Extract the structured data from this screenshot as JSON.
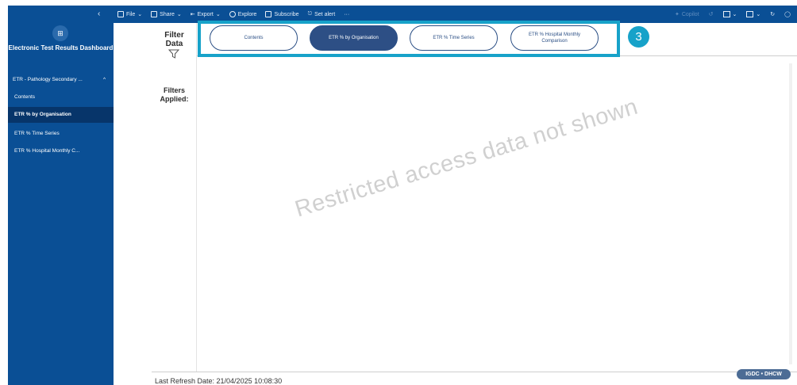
{
  "toolbar": {
    "collapse_icon": "chevron-left-icon",
    "items": [
      {
        "label": "File",
        "icon": "file-icon"
      },
      {
        "label": "Share",
        "icon": "share-icon"
      },
      {
        "label": "Export",
        "icon": "export-icon"
      },
      {
        "label": "Explore",
        "icon": "explore-icon"
      },
      {
        "label": "Subscribe",
        "icon": "subscribe-icon"
      },
      {
        "label": "Set alert",
        "icon": "bell-icon"
      },
      {
        "label": "···",
        "icon": "more-icon"
      }
    ],
    "copilot_label": "Copilot",
    "right_icons": [
      "undo-icon",
      "bookmark-icon",
      "view-icon",
      "refresh-icon",
      "comment-icon"
    ]
  },
  "sidebar": {
    "logo_text": "⊞",
    "title": "Electronic Test Results Dashboard",
    "group_label": "ETR - Pathology Secondary ...",
    "group_chevron": "^",
    "items": [
      {
        "label": "Contents"
      },
      {
        "label": "ETR % by Organisation"
      },
      {
        "label": "ETR % Time Series"
      },
      {
        "label": "ETR % Hospital Monthly C..."
      }
    ]
  },
  "filter_panel": {
    "filter_data_label": "Filter Data",
    "filters_applied_label": "Filters Applied:"
  },
  "tabs": [
    {
      "label": "Contents"
    },
    {
      "label": "ETR % by Organisation"
    },
    {
      "label": "ETR % Time Series"
    },
    {
      "label": "ETR % Hospital Monthly Comparison"
    }
  ],
  "step_badge": "3",
  "watermark": "Restricted access data not shown",
  "footer": {
    "last_refresh": "Last Refresh Date: 21/04/2025 10:08:30",
    "badge": "IGDC • DHCW"
  },
  "colors": {
    "sidebar_bg": "#0a4f95",
    "active_nav": "#07356a",
    "highlight": "#17a2c9",
    "tab_active": "#2d4f85"
  }
}
